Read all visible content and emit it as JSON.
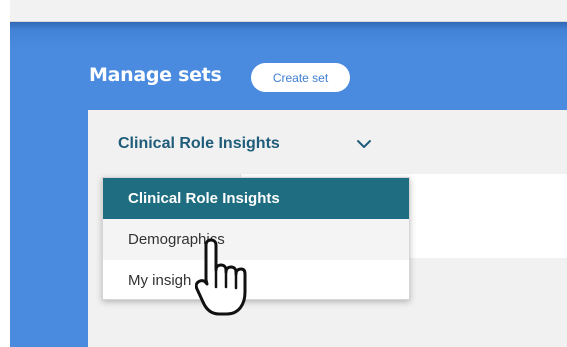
{
  "header": {
    "title": "Manage sets",
    "create_button_label": "Create set"
  },
  "selector": {
    "selected_set": "Clinical Role Insights",
    "chevron_icon": "chevron-down-icon"
  },
  "dropdown": {
    "items": [
      {
        "label": "Clinical Role Insights",
        "state": "selected"
      },
      {
        "label": "Demographics",
        "state": "hovered"
      },
      {
        "label": "My insights",
        "state": "normal",
        "visible_text": "My insigh"
      }
    ]
  },
  "colors": {
    "panel_blue": "#4a8be0",
    "selected_teal": "#1f6d80",
    "selector_text": "#1f5d7a"
  },
  "cursor": {
    "icon": "hand-pointer-icon"
  }
}
